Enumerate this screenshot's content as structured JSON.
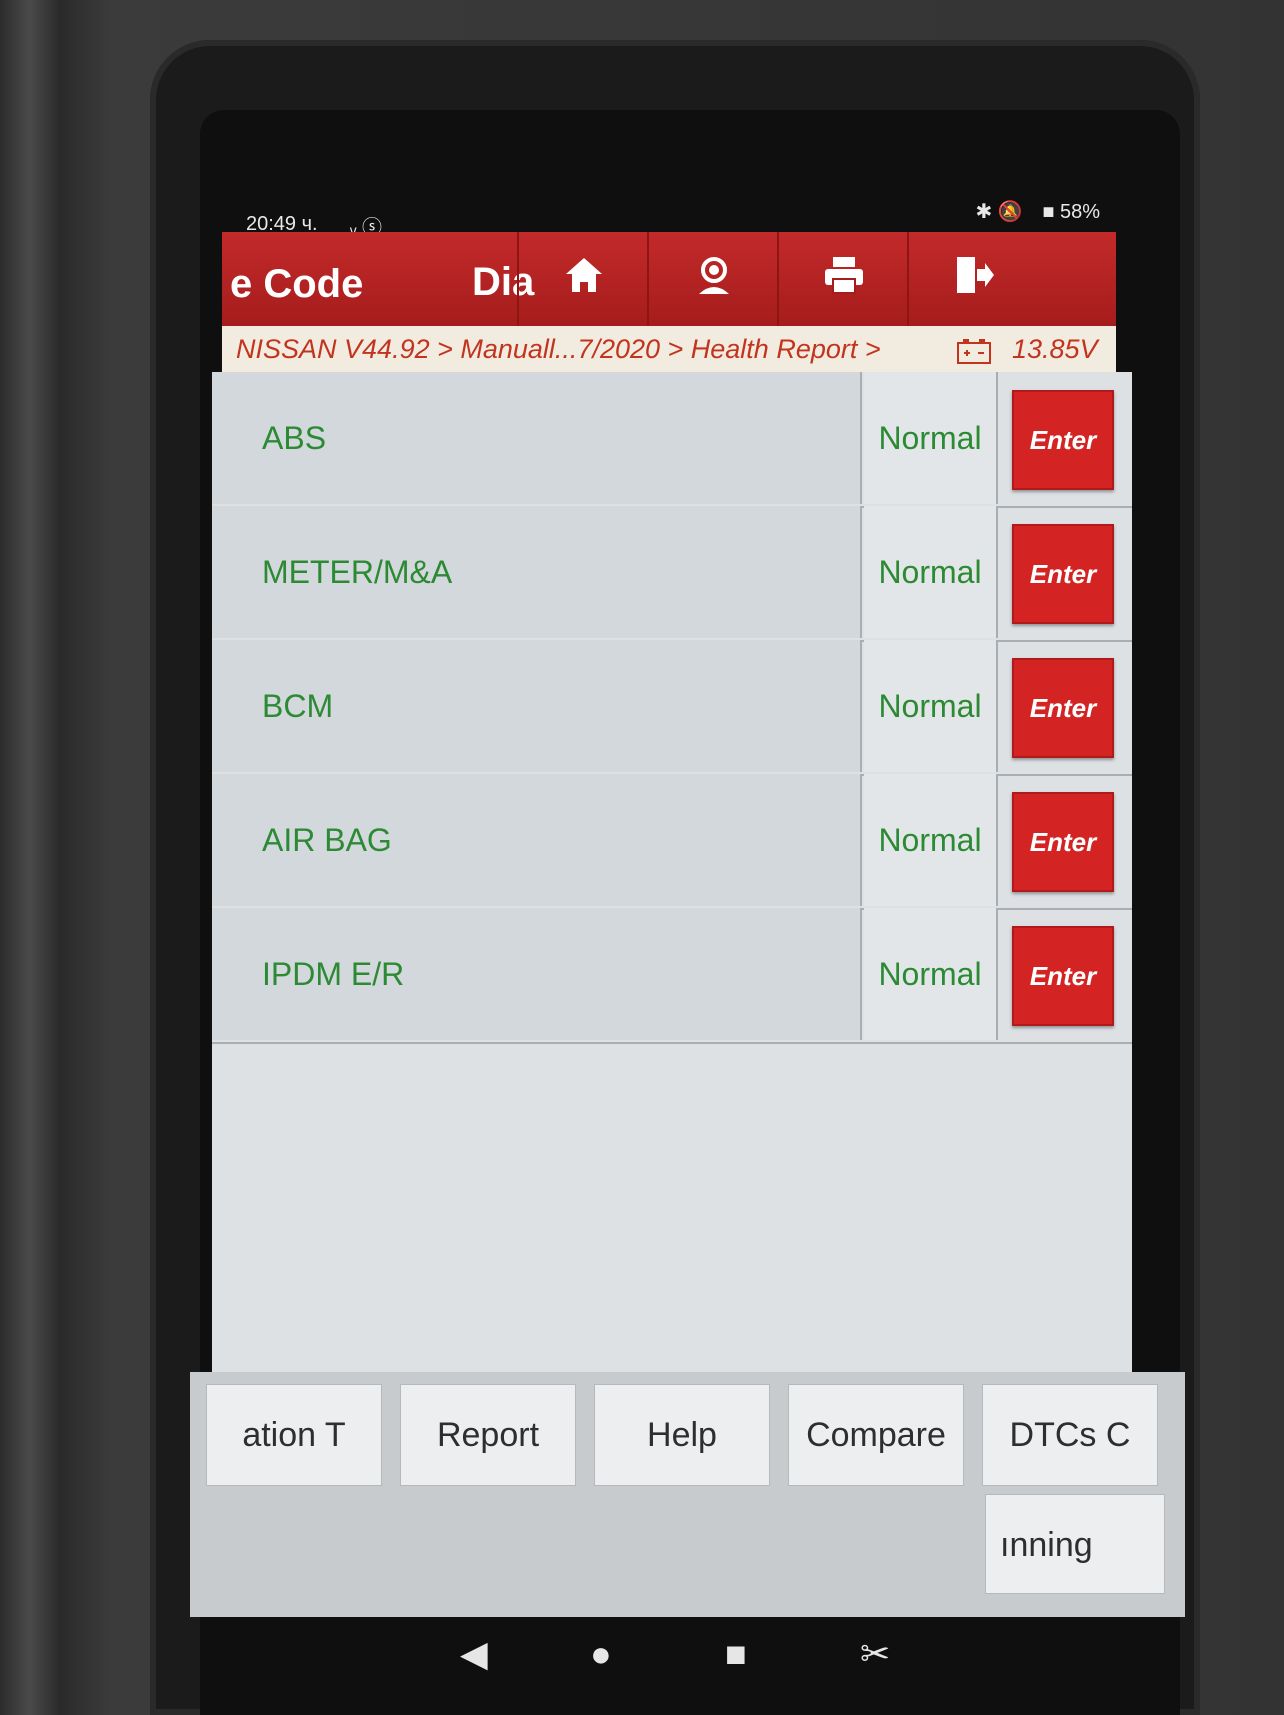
{
  "status_bar": {
    "time": "20:49 ч.",
    "left_icons": "ᵥ ⓢ",
    "right_icons": "✱ 🔕",
    "battery": "■ 58%"
  },
  "app_bar": {
    "title": "e Code",
    "tab_dia": "Dia",
    "tools": [
      "home-icon",
      "support-icon",
      "print-icon",
      "exit-icon"
    ]
  },
  "breadcrumb": {
    "path": "NISSAN V44.92 > Manuall...7/2020 > Health Report >",
    "voltage": "13.85V"
  },
  "systems": [
    {
      "name": "ABS",
      "status": "Normal",
      "action": "Enter"
    },
    {
      "name": "METER/M&A",
      "status": "Normal",
      "action": "Enter"
    },
    {
      "name": "BCM",
      "status": "Normal",
      "action": "Enter"
    },
    {
      "name": "AIR BAG",
      "status": "Normal",
      "action": "Enter"
    },
    {
      "name": "IPDM E/R",
      "status": "Normal",
      "action": "Enter"
    }
  ],
  "bottom_buttons": [
    "ation      T",
    "Report",
    "Help",
    "Compare",
    "DTCs      C"
  ],
  "bottom_button_2": "ınning",
  "nav": {
    "back": "◀",
    "home": "●",
    "recent": "■",
    "screenshot": "✂"
  }
}
